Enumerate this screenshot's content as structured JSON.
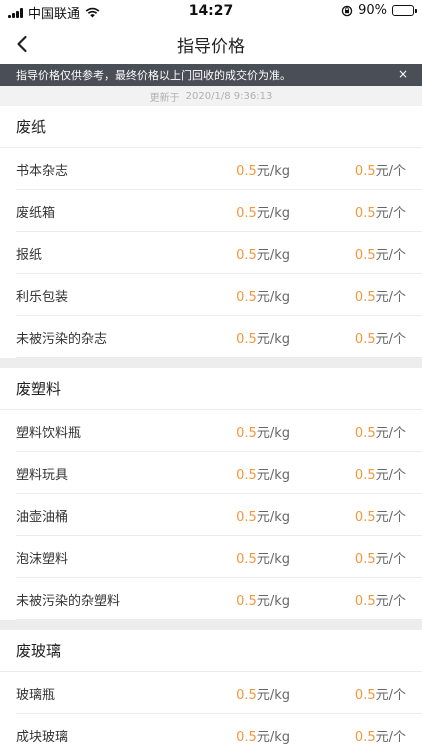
{
  "status_bar": {
    "carrier": "中国联通",
    "time": "14:27",
    "battery_percent": "90%",
    "battery_level": 0.9,
    "battery_color": "#4cd964"
  },
  "nav": {
    "title": "指导价格",
    "back_icon": "chevron-left-icon"
  },
  "notice": {
    "text": "指导价格仅供参考，最终价格以上门回收的成交价为准。",
    "close": "×",
    "background": "#4a4e57"
  },
  "update": {
    "label": "更新于",
    "datetime": "2020/1/8 9:36:13"
  },
  "colors": {
    "price_accent": "#f2973b"
  },
  "sections": [
    {
      "title": "废纸",
      "items": [
        {
          "name": "书本杂志",
          "kg_value": "0.5",
          "kg_unit": "元/kg",
          "each_value": "0.5",
          "each_unit": "元/个"
        },
        {
          "name": "废纸箱",
          "kg_value": "0.5",
          "kg_unit": "元/kg",
          "each_value": "0.5",
          "each_unit": "元/个"
        },
        {
          "name": "报纸",
          "kg_value": "0.5",
          "kg_unit": "元/kg",
          "each_value": "0.5",
          "each_unit": "元/个"
        },
        {
          "name": "利乐包装",
          "kg_value": "0.5",
          "kg_unit": "元/kg",
          "each_value": "0.5",
          "each_unit": "元/个"
        },
        {
          "name": "未被污染的杂志",
          "kg_value": "0.5",
          "kg_unit": "元/kg",
          "each_value": "0.5",
          "each_unit": "元/个"
        }
      ]
    },
    {
      "title": "废塑料",
      "items": [
        {
          "name": "塑料饮料瓶",
          "kg_value": "0.5",
          "kg_unit": "元/kg",
          "each_value": "0.5",
          "each_unit": "元/个"
        },
        {
          "name": "塑料玩具",
          "kg_value": "0.5",
          "kg_unit": "元/kg",
          "each_value": "0.5",
          "each_unit": "元/个"
        },
        {
          "name": "油壶油桶",
          "kg_value": "0.5",
          "kg_unit": "元/kg",
          "each_value": "0.5",
          "each_unit": "元/个"
        },
        {
          "name": "泡沫塑料",
          "kg_value": "0.5",
          "kg_unit": "元/kg",
          "each_value": "0.5",
          "each_unit": "元/个"
        },
        {
          "name": "未被污染的杂塑料",
          "kg_value": "0.5",
          "kg_unit": "元/kg",
          "each_value": "0.5",
          "each_unit": "元/个"
        }
      ]
    },
    {
      "title": "废玻璃",
      "items": [
        {
          "name": "玻璃瓶",
          "kg_value": "0.5",
          "kg_unit": "元/kg",
          "each_value": "0.5",
          "each_unit": "元/个"
        },
        {
          "name": "成块玻璃",
          "kg_value": "0.5",
          "kg_unit": "元/kg",
          "each_value": "0.5",
          "each_unit": "元/个"
        }
      ]
    }
  ]
}
